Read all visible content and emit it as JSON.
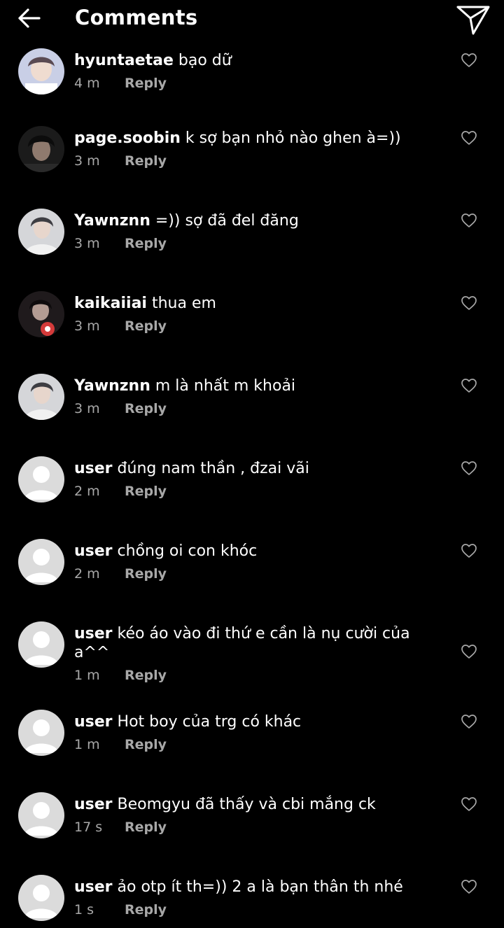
{
  "header": {
    "back_icon": "arrow-left-icon",
    "title": "Comments",
    "send_icon": "paper-plane-icon"
  },
  "reply_label": "Reply",
  "comments": [
    {
      "user": "hyuntaetae",
      "text": "bạo dữ",
      "time": "4 m",
      "avatar": "photo-light"
    },
    {
      "user": "page.soobin",
      "text": "k sợ bạn nhỏ nào ghen à=))",
      "time": "3 m",
      "avatar": "photo-dark"
    },
    {
      "user": "Yawnznn",
      "text": "=)) sợ đã đel đăng",
      "time": "3 m",
      "avatar": "photo-grey"
    },
    {
      "user": "kaikaiiai",
      "text": "thua em",
      "time": "3 m",
      "avatar": "photo-night"
    },
    {
      "user": "Yawnznn",
      "text": "m là nhất m khoải",
      "time": "3 m",
      "avatar": "photo-grey"
    },
    {
      "user": "user",
      "text": "đúng nam thần , đzai vãi",
      "time": "2 m",
      "avatar": "default"
    },
    {
      "user": "user",
      "text": "chồng oi con khóc",
      "time": "2 m",
      "avatar": "default"
    },
    {
      "user": "user",
      "text": "kéo áo vào đi thứ e cần là nụ cười của a^^",
      "time": "1 m",
      "avatar": "default"
    },
    {
      "user": "user",
      "text": "Hot boy của trg có khác",
      "time": "1 m",
      "avatar": "default"
    },
    {
      "user": "user",
      "text": "Beomgyu đã thấy và cbi mắng ck",
      "time": "17 s",
      "avatar": "default"
    },
    {
      "user": "user",
      "text": "ảo otp ít th=)) 2 a là bạn thân th nhé",
      "time": "1 s",
      "avatar": "default"
    }
  ],
  "colors": {
    "background": "#000000",
    "text": "#ffffff",
    "meta": "#a8a8a8",
    "default_avatar_bg": "#dbdbdb",
    "default_avatar_fg": "#ffffff"
  }
}
